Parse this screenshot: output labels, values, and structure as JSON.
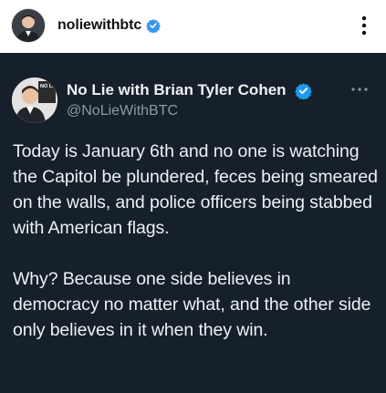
{
  "post_header": {
    "username": "noliewithbtc",
    "avatar_icon": "profile-photo-icon",
    "verified_icon": "verified-badge-icon",
    "more_icon": "more-vertical-icon",
    "verified_color": "#3897f0"
  },
  "tweet": {
    "display_name": "No Lie with Brian Tyler Cohen",
    "handle": "@NoLieWithBTC",
    "avatar_icon": "profile-photo-icon",
    "avatar_badge_text": "NO LIE",
    "verified_icon": "verified-badge-icon",
    "more_icon": "more-horizontal-icon",
    "paragraphs": [
      "Today is January 6th and no one is watching the Capitol be plundered, feces being smeared on the walls, and police officers being stabbed with American flags.",
      "Why? Because one side believes in democracy no matter what, and the other side only believes in it when they win."
    ],
    "background_color": "#15202b",
    "verified_color": "#1d9bf0"
  }
}
